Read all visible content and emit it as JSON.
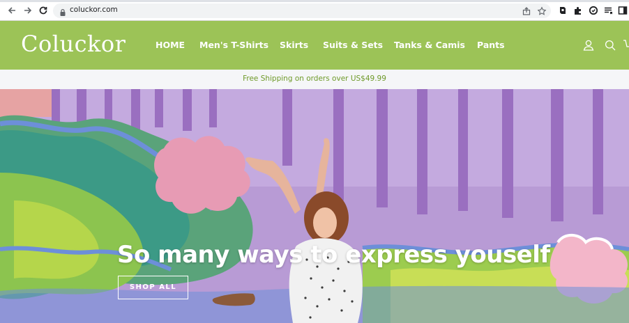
{
  "browser": {
    "url": "coluckor.com",
    "toolbar_icons": [
      "back-icon",
      "forward-icon",
      "reload-icon",
      "home-icon",
      "lock-icon",
      "share-icon",
      "star-icon"
    ],
    "extension_icons": [
      "extension-cube-icon",
      "puzzle-icon",
      "extension-circle-icon",
      "reading-list-icon",
      "side-panel-icon"
    ]
  },
  "header": {
    "logo": "Coluckor",
    "nav": [
      {
        "label": "HOME"
      },
      {
        "label": "Men's T-Shirts"
      },
      {
        "label": "Skirts"
      },
      {
        "label": "Suits & Sets"
      },
      {
        "label": "Tanks & Camis"
      },
      {
        "label": "Pants"
      }
    ],
    "icons": [
      "account-icon",
      "search-icon",
      "cart-icon"
    ],
    "background": "#9cc357"
  },
  "announcement": {
    "text": "Free Shipping on orders over US$49.99",
    "color": "#6f9a2a"
  },
  "hero": {
    "title": "So many ways to express youself",
    "button": "SHOP ALL"
  }
}
